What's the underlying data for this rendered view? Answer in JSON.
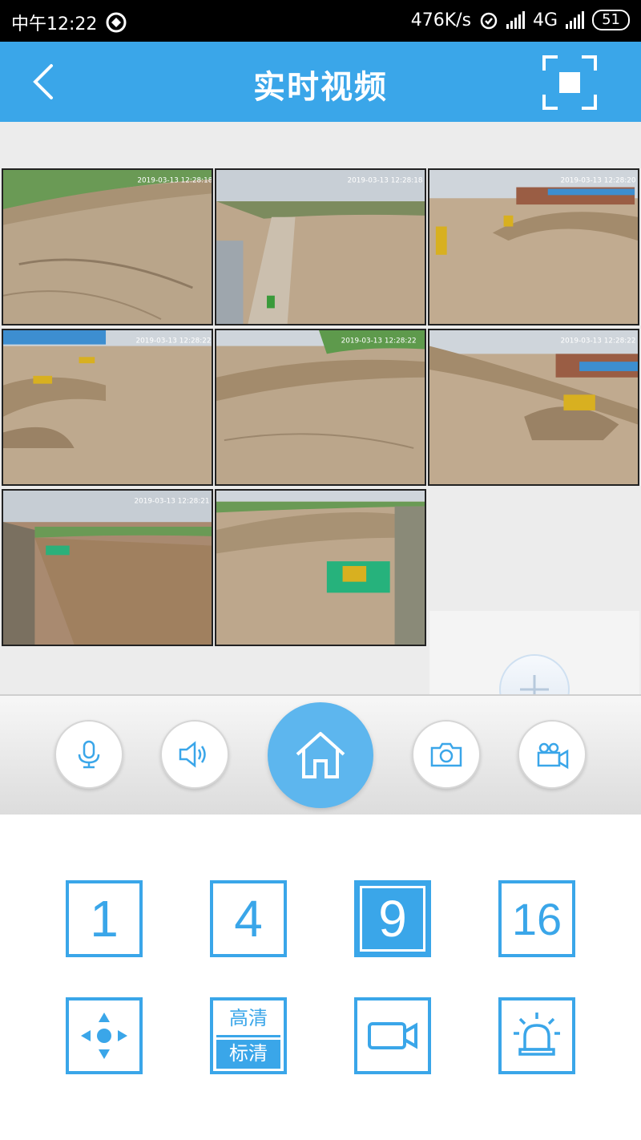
{
  "status_bar": {
    "time": "中午12:22",
    "speed": "476K/s",
    "network": "4G",
    "battery": "51"
  },
  "header": {
    "title": "实时视频"
  },
  "video_grid": {
    "cameras": [
      {
        "timestamp": "2019-03-13 12:28:18"
      },
      {
        "timestamp": "2019-03-13 12:28:18"
      },
      {
        "timestamp": "2019-03-13 12:28:20"
      },
      {
        "timestamp": "2019-03-13 12:28:22"
      },
      {
        "timestamp": "2019-03-13 12:28:22"
      },
      {
        "timestamp": "2019-03-13 12:28:22"
      },
      {
        "timestamp": "2019-03-13 12:28:21"
      },
      {
        "timestamp": ""
      }
    ]
  },
  "toolbar": {
    "icons": [
      "microphone-icon",
      "speaker-icon",
      "home-icon",
      "camera-icon",
      "video-camera-icon"
    ]
  },
  "layout_panel": {
    "split_options": [
      "1",
      "4",
      "9",
      "16"
    ],
    "selected_split": "9",
    "quality_top": "高清",
    "quality_bottom": "标清"
  },
  "colors": {
    "accent": "#3aa6e9",
    "home": "#5db6ee",
    "statusbar": "#000000"
  }
}
